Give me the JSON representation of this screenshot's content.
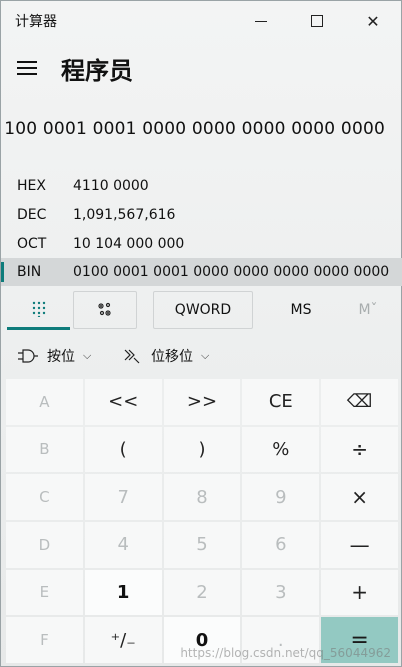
{
  "titlebar": {
    "app_title": "计算器"
  },
  "header": {
    "mode_title": "程序员"
  },
  "display": {
    "value": "100 0001 0001 0000 0000 0000 0000 0000"
  },
  "radix": [
    {
      "label": "HEX",
      "value": "4110 0000",
      "selected": false
    },
    {
      "label": "DEC",
      "value": "1,091,567,616",
      "selected": false
    },
    {
      "label": "OCT",
      "value": "10 104 000 000",
      "selected": false
    },
    {
      "label": "BIN",
      "value": "0100 0001 0001 0000 0000 0000 0000 0000",
      "selected": true
    }
  ],
  "toolbar": {
    "word_size": "QWORD",
    "ms_label": "MS",
    "mdrop_label": "Mˇ"
  },
  "options": {
    "bitwise_label": "按位",
    "bitshift_label": "位移位"
  },
  "keys": {
    "r1": [
      "A",
      "<<",
      ">>",
      "CE",
      "⌫"
    ],
    "r2": [
      "B",
      "(",
      ")",
      "%",
      "÷"
    ],
    "r3": [
      "C",
      "7",
      "8",
      "9",
      "×"
    ],
    "r4": [
      "D",
      "4",
      "5",
      "6",
      "—"
    ],
    "r5": [
      "E",
      "1",
      "2",
      "3",
      "+"
    ],
    "r6": [
      "F",
      "⁺/₋",
      "0",
      ".",
      "="
    ]
  },
  "watermark": "https://blog.csdn.net/qq_56044962",
  "colors": {
    "accent": "#0e7c7b",
    "equals_bg": "#93c9c2"
  }
}
